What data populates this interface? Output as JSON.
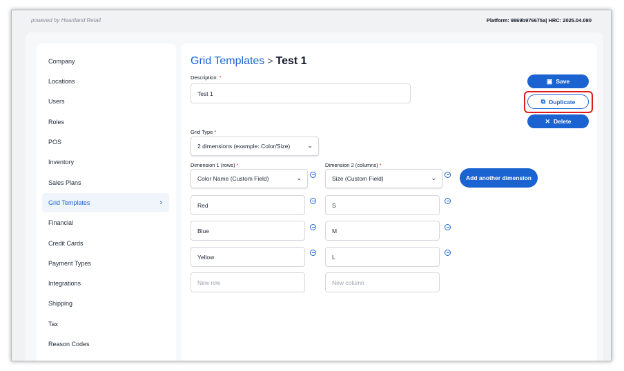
{
  "header": {
    "powered_by": "powered by Heartland Retail",
    "platform": "Platform: 9869b976675a| HRC: 2025.04.080"
  },
  "sidebar": {
    "items": [
      {
        "label": "Company"
      },
      {
        "label": "Locations"
      },
      {
        "label": "Users"
      },
      {
        "label": "Roles"
      },
      {
        "label": "POS"
      },
      {
        "label": "Inventory"
      },
      {
        "label": "Sales Plans"
      },
      {
        "label": "Grid Templates",
        "active": true
      },
      {
        "label": "Financial"
      },
      {
        "label": "Credit Cards"
      },
      {
        "label": "Payment Types"
      },
      {
        "label": "Integrations"
      },
      {
        "label": "Shipping"
      },
      {
        "label": "Tax"
      },
      {
        "label": "Reason Codes"
      }
    ]
  },
  "breadcrumb": {
    "parent": "Grid Templates",
    "separator": ">",
    "current": "Test 1"
  },
  "form": {
    "description_label": "Description:",
    "description_value": "Test 1",
    "grid_type_label": "Grid Type",
    "grid_type_value": "2 dimensions (example: Color/Size)",
    "dimension1_label": "Dimension 1 (rows)",
    "dimension1_value": "Color Name (Custom Field)",
    "dimension2_label": "Dimension 2 (columns)",
    "dimension2_value": "Size (Custom Field)",
    "required_mark": "*",
    "rows": [
      "Red",
      "Blue",
      "Yellow"
    ],
    "columns": [
      "S",
      "M",
      "L"
    ],
    "new_row_placeholder": "New row",
    "new_column_placeholder": "New column"
  },
  "actions": {
    "save": "Save",
    "duplicate": "Duplicate",
    "delete": "Delete",
    "add_dimension": "Add another dimension"
  },
  "colors": {
    "accent": "#1b63d1",
    "highlight": "#e01b1b",
    "required": "#dc2626"
  }
}
